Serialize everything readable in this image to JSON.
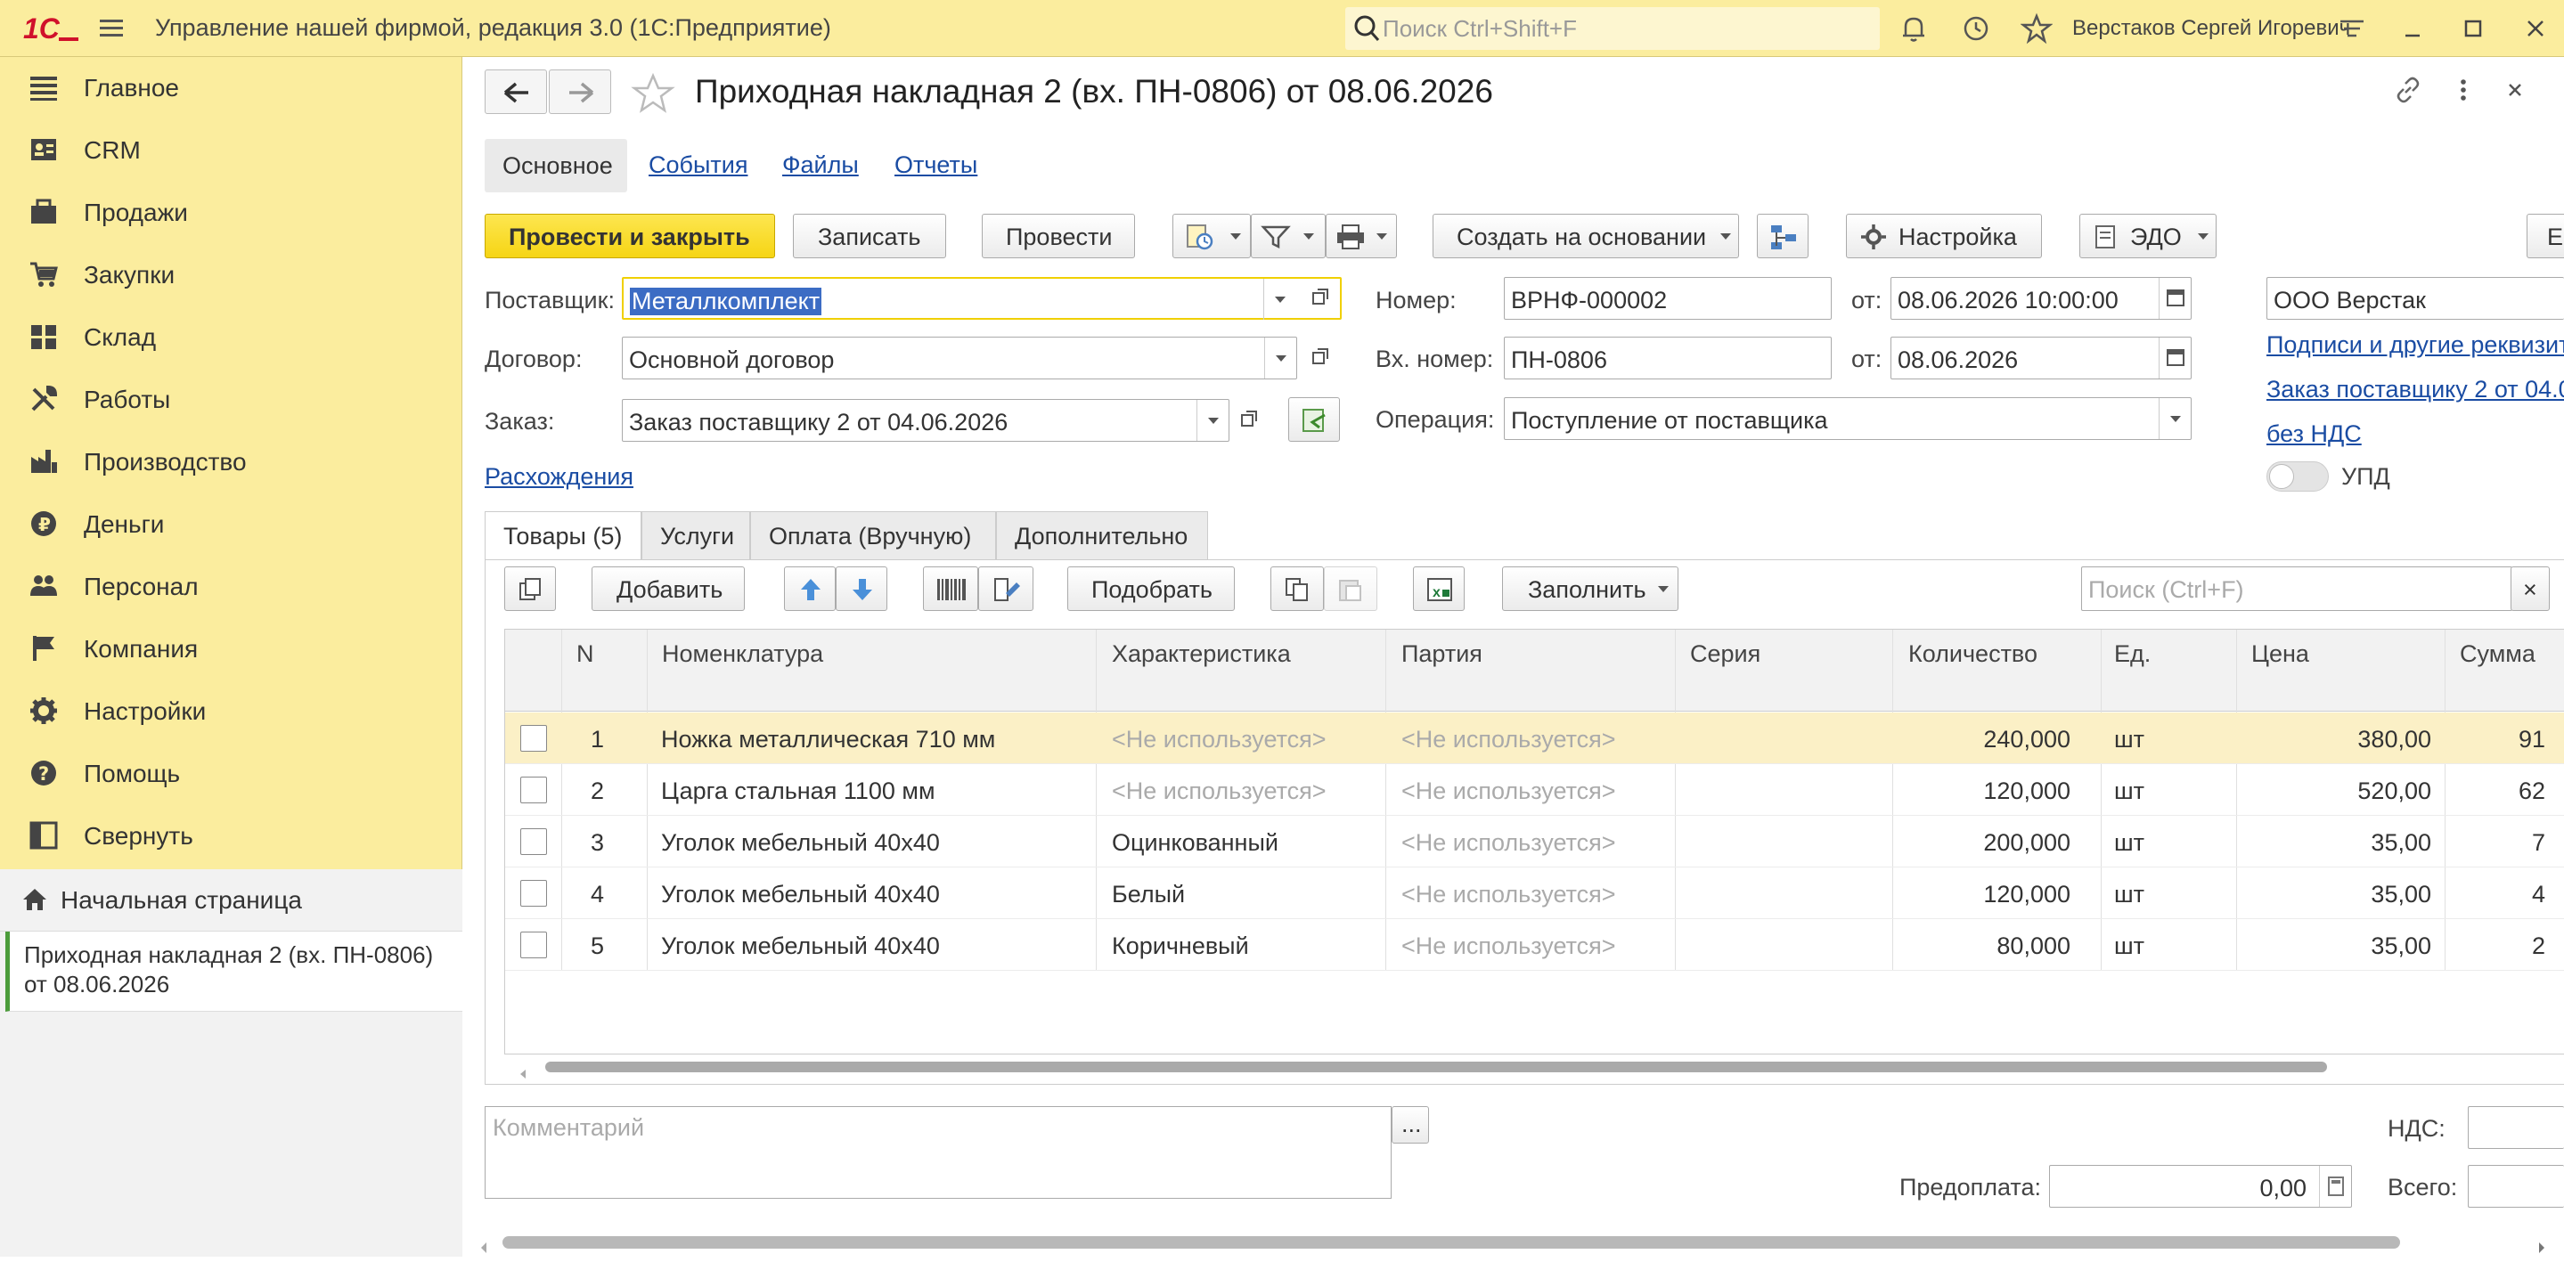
{
  "app": {
    "title": "Управление нашей фирмой, редакция 3.0  (1С:Предприятие)",
    "logo_text": "1С",
    "search_placeholder": "Поиск Ctrl+Shift+F",
    "user": "Верстаков Сергей Игоревич"
  },
  "sidebar": {
    "items": [
      {
        "label": "Главное",
        "icon": "list-icon"
      },
      {
        "label": "CRM",
        "icon": "contact-card-icon"
      },
      {
        "label": "Продажи",
        "icon": "sales-icon"
      },
      {
        "label": "Закупки",
        "icon": "cart-icon"
      },
      {
        "label": "Склад",
        "icon": "warehouse-icon"
      },
      {
        "label": "Работы",
        "icon": "tools-icon"
      },
      {
        "label": "Производство",
        "icon": "factory-icon"
      },
      {
        "label": "Деньги",
        "icon": "ruble-icon"
      },
      {
        "label": "Персонал",
        "icon": "people-icon"
      },
      {
        "label": "Компания",
        "icon": "flag-icon"
      },
      {
        "label": "Настройки",
        "icon": "gear-icon"
      },
      {
        "label": "Помощь",
        "icon": "help-icon"
      },
      {
        "label": "Свернуть",
        "icon": "collapse-icon"
      }
    ],
    "home": "Начальная страница",
    "open_doc": "Приходная накладная 2 (вх. ПН-0806) от 08.06.2026"
  },
  "doc": {
    "title": "Приходная накладная 2 (вх. ПН-0806) от 08.06.2026",
    "tabs": [
      "Основное",
      "События",
      "Файлы",
      "Отчеты"
    ],
    "toolbar": {
      "post_close": "Провести и закрыть",
      "save": "Записать",
      "post": "Провести",
      "create_based": "Создать на основании",
      "settings": "Настройка",
      "edo": "ЭДО",
      "more": "Е"
    },
    "fields": {
      "supplier_label": "Поставщик:",
      "supplier": "Металлкомплект",
      "contract_label": "Договор:",
      "contract": "Основной договор",
      "order_label": "Заказ:",
      "order": "Заказ поставщику 2 от 04.06.2026",
      "number_label": "Номер:",
      "number": "ВРНФ-000002",
      "from_label": "от:",
      "date": "08.06.2026 10:00:00",
      "in_number_label": "Вх. номер:",
      "in_number": "ПН-0806",
      "in_date": "08.06.2026",
      "operation_label": "Операция:",
      "operation": "Поступление от поставщика",
      "company": "ООО Верстак",
      "discrepancies": "Расхождения",
      "signatures_link": "Подписи и другие реквизит",
      "order_link": "Заказ поставщику 2 от 04.0",
      "vat_link": "без НДС",
      "upd_label": "УПД"
    },
    "inner_tabs": [
      "Товары (5)",
      "Услуги",
      "Оплата (Вручную)",
      "Дополнительно"
    ],
    "table_toolbar": {
      "add": "Добавить",
      "pick": "Подобрать",
      "fill": "Заполнить",
      "search_placeholder": "Поиск (Ctrl+F)",
      "clear": "×"
    },
    "table": {
      "columns": [
        "N",
        "Номенклатура",
        "Характеристика",
        "Партия",
        "Серия",
        "Количество",
        "Ед.",
        "Цена",
        "Сумма"
      ],
      "rows": [
        {
          "n": "1",
          "name": "Ножка металлическая 710 мм",
          "char": "<Не используется>",
          "batch": "<Не используется>",
          "series": "",
          "qty": "240,000",
          "unit": "шт",
          "price": "380,00",
          "sum": "91"
        },
        {
          "n": "2",
          "name": "Царга стальная 1100 мм",
          "char": "<Не используется>",
          "batch": "<Не используется>",
          "series": "",
          "qty": "120,000",
          "unit": "шт",
          "price": "520,00",
          "sum": "62"
        },
        {
          "n": "3",
          "name": "Уголок мебельный 40х40",
          "char": "Оцинкованный",
          "batch": "<Не используется>",
          "series": "",
          "qty": "200,000",
          "unit": "шт",
          "price": "35,00",
          "sum": "7"
        },
        {
          "n": "4",
          "name": "Уголок мебельный 40х40",
          "char": "Белый",
          "batch": "<Не используется>",
          "series": "",
          "qty": "120,000",
          "unit": "шт",
          "price": "35,00",
          "sum": "4"
        },
        {
          "n": "5",
          "name": "Уголок мебельный 40х40",
          "char": "Коричневый",
          "batch": "<Не используется>",
          "series": "",
          "qty": "80,000",
          "unit": "шт",
          "price": "35,00",
          "sum": "2"
        }
      ]
    },
    "footer": {
      "comment_placeholder": "Комментарий",
      "comment_more": "...",
      "vat_label": "НДС:",
      "prepay_label": "Предоплата:",
      "prepay": "0,00",
      "total_label": "Всего:"
    }
  }
}
